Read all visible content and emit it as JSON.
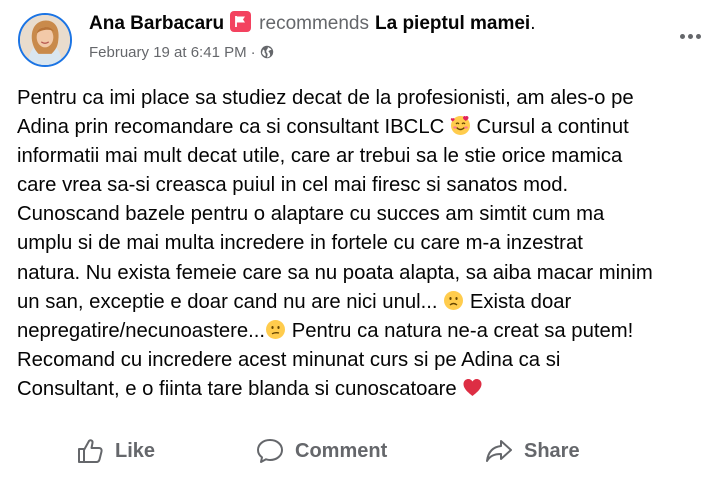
{
  "post": {
    "author": "Ana Barbacaru",
    "verb": "recommends",
    "page": "La pieptul mamei",
    "period": ".",
    "timestamp": "February 19 at 6:41 PM",
    "separator": "·",
    "audience_icon": "globe-icon",
    "badge_icon": "recommendation-flag-icon",
    "more_icon": "more-options-icon"
  },
  "body_lines": [
    "Pentru ca imi place sa studiez decat de la profesionisti, am ales-o pe",
    "Adina prin recomandare ca si consultant IBCLC",
    " Cursul a continut",
    "informatii mai mult decat utile, care ar trebui sa le stie orice mamica",
    "care vrea sa-si creasca puiul in cel mai firesc si sanatos mod.",
    "Cunoscand bazele pentru o alaptare cu succes am simtit cum ma",
    "umplu si de mai multa incredere in fortele cu care m-a inzestrat",
    "natura. Nu exista femeie care sa nu poata alapta, sa aiba macar minim",
    "un san, exceptie e doar cand nu are nici unul... ",
    " Exista doar",
    "nepregatire/necunoastere...",
    " Pentru ca natura ne-a creat sa putem!",
    "Recomand cu incredere acest minunat curs si pe Adina ca si",
    "Consultant, e o fiinta tare blanda si cunoscatoare "
  ],
  "emojis": {
    "smiling_hearts": "smiling-face-with-hearts-icon",
    "frowning": "frowning-face-icon",
    "confused": "confused-face-icon",
    "red_heart": "red-heart-icon"
  },
  "actions": {
    "like": "Like",
    "comment": "Comment",
    "share": "Share"
  },
  "colors": {
    "text": "#050505",
    "secondary": "#65676b",
    "badge": "#f3425f",
    "avatar_ring": "#1b74e4"
  }
}
